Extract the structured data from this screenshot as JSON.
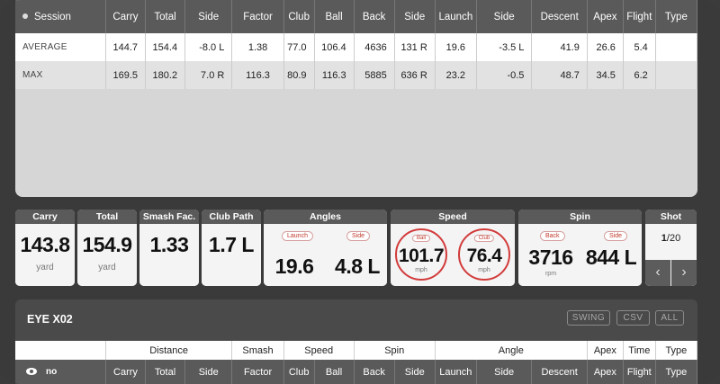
{
  "stats": {
    "headers": [
      "Session",
      "Carry",
      "Total",
      "Side",
      "Factor",
      "Club",
      "Ball",
      "Back",
      "Side",
      "Launch",
      "Side",
      "Descent",
      "Apex",
      "Flight",
      "Type"
    ],
    "rows": [
      {
        "label": "AVERAGE",
        "values": [
          "144.7",
          "154.4",
          "-8.0 L",
          "1.38",
          "77.0",
          "106.4",
          "4636",
          "131 R",
          "19.6",
          "-3.5 L",
          "41.9",
          "26.6",
          "5.4",
          ""
        ]
      },
      {
        "label": "MAX",
        "values": [
          "169.5",
          "180.2",
          "7.0 R",
          "116.3",
          "80.9",
          "116.3",
          "5885",
          "636 R",
          "23.2",
          "-0.5",
          "48.7",
          "34.5",
          "6.2",
          ""
        ]
      }
    ]
  },
  "cards": {
    "carry": {
      "title": "Carry",
      "value": "143.8",
      "unit": "yard"
    },
    "total": {
      "title": "Total",
      "value": "154.9",
      "unit": "yard"
    },
    "smash": {
      "title": "Smash Fac.",
      "value": "1.33"
    },
    "clubpath": {
      "title": "Club Path",
      "value": "1.7 L"
    },
    "angles": {
      "title": "Angles",
      "launch_label": "Launch",
      "launch_value": "19.6",
      "side_label": "Side",
      "side_value": "4.8 L"
    },
    "speed": {
      "title": "Speed",
      "ball_label": "Ball",
      "ball_value": "101.7",
      "ball_unit": "mph",
      "club_label": "Club",
      "club_value": "76.4",
      "club_unit": "mph"
    },
    "spin": {
      "title": "Spin",
      "back_label": "Back",
      "back_value": "3716",
      "back_unit": "rpm",
      "side_label": "Side",
      "side_value": "844 L"
    },
    "shot": {
      "title": "Shot",
      "current": "1",
      "total": "/20",
      "prev_icon": "chevron-left-icon",
      "next_icon": "chevron-right-icon"
    }
  },
  "panel": {
    "title": "EYE X02",
    "buttons": [
      "SWING",
      "CSV",
      "ALL"
    ],
    "groups": [
      "",
      "Distance",
      "Smash",
      "Speed",
      "Spin",
      "Angle",
      "Apex",
      "Time",
      "Type"
    ],
    "sub_headers": [
      "no",
      "Carry",
      "Total",
      "Side",
      "Factor",
      "Club",
      "Ball",
      "Back",
      "Side",
      "Launch",
      "Side",
      "Descent",
      "Apex",
      "Flight",
      "Type"
    ]
  },
  "colors": {
    "accent_ring": "#d23b3b",
    "header_bg": "#5a5a5a",
    "table_bg": "#d6d6d6"
  }
}
